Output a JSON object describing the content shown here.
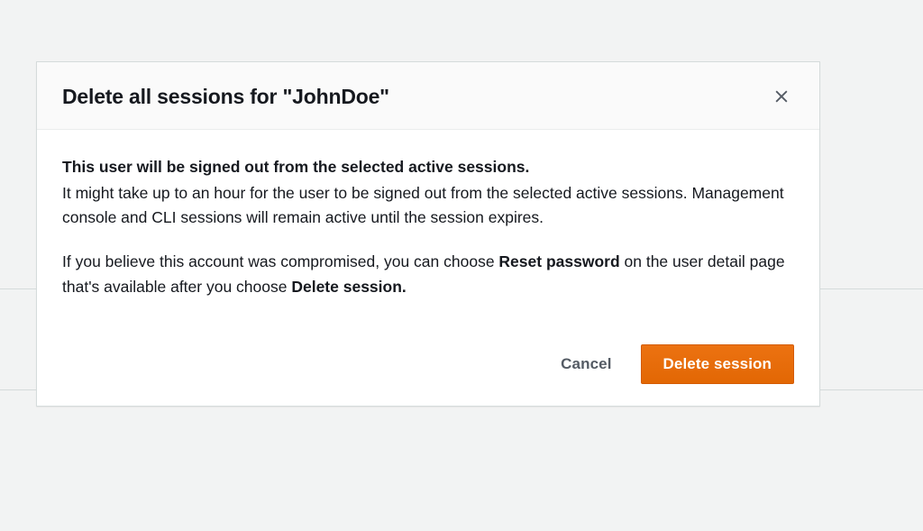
{
  "modal": {
    "title": "Delete all sessions for \"JohnDoe\"",
    "strong_line": "This user will be signed out from the selected active sessions.",
    "paragraph1": "It might take up to an hour for the user to be signed out from the selected active sessions. Management console and CLI sessions will remain active until the session expires.",
    "paragraph2_pre": "If you believe this account was compromised, you can choose ",
    "paragraph2_bold1": "Reset password",
    "paragraph2_mid": " on the user detail page that's available after you choose ",
    "paragraph2_bold2": "Delete session.",
    "cancel_label": "Cancel",
    "confirm_label": "Delete session"
  }
}
